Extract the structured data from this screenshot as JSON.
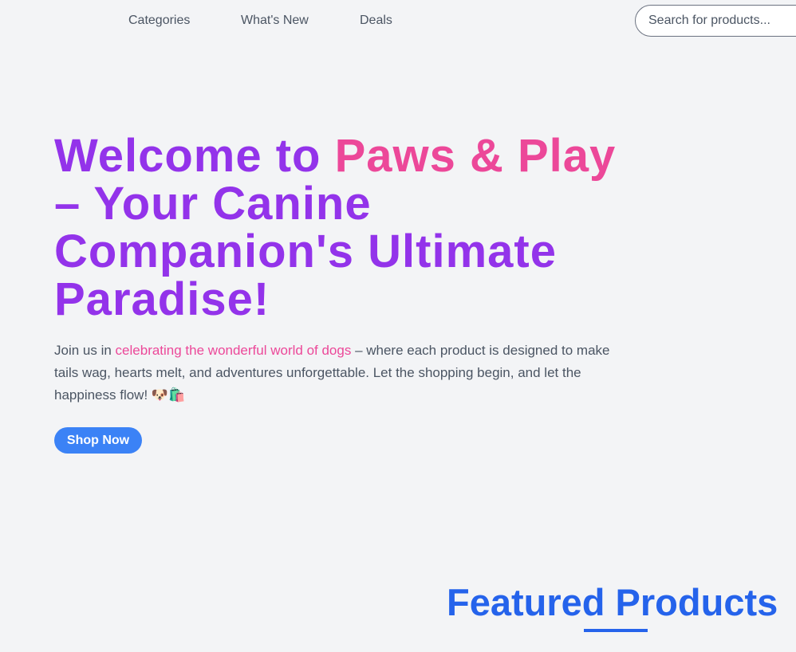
{
  "nav": {
    "links": [
      "Categories",
      "What's New",
      "Deals"
    ]
  },
  "search": {
    "placeholder": "Search for products..."
  },
  "hero": {
    "title_part1": "Welcome to ",
    "title_highlight": "Paws & Play",
    "title_part2": " – Your Canine Companion's Ultimate Paradise!",
    "desc_part1": "Join us in ",
    "desc_highlight": "celebrating the wonderful world of dogs",
    "desc_part2": " – where each product is designed to make tails wag, hearts melt, and adventures unforgettable. Let the shopping begin, and let the happiness flow! 🐶🛍️",
    "button_label": "Shop Now"
  },
  "featured": {
    "title": "Featured Products"
  },
  "colors": {
    "background": "#f3f4f6",
    "title_purple": "#9333ea",
    "accent_pink": "#ec4899",
    "button_blue": "#3b82f6",
    "heading_blue": "#2563eb"
  }
}
